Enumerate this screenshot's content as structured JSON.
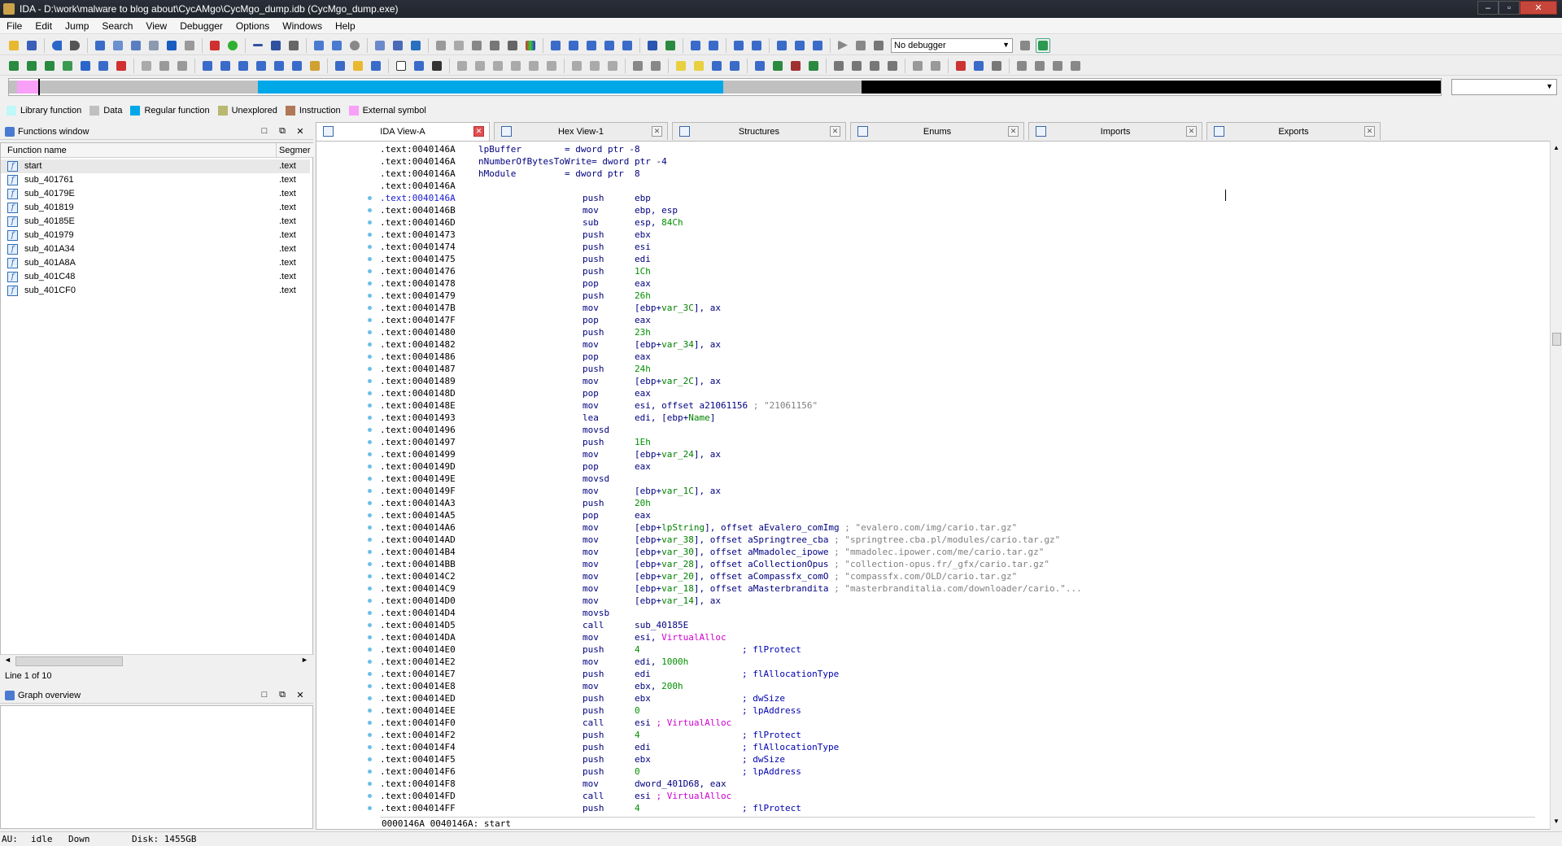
{
  "window": {
    "title": "IDA - D:\\work\\malware to blog about\\CycAMgo\\CycMgo_dump.idb (CycMgo_dump.exe)",
    "min": "–",
    "max": "▫",
    "close": "✕"
  },
  "menu": [
    "File",
    "Edit",
    "Jump",
    "Search",
    "View",
    "Debugger",
    "Options",
    "Windows",
    "Help"
  ],
  "toolbar": {
    "debugger_select": "No debugger"
  },
  "legend": [
    {
      "label": "Library function",
      "color": "#c0f8f8"
    },
    {
      "label": "Data",
      "color": "#c0c0c0"
    },
    {
      "label": "Regular function",
      "color": "#00a8e8"
    },
    {
      "label": "Unexplored",
      "color": "#b8b870"
    },
    {
      "label": "Instruction",
      "color": "#b07858"
    },
    {
      "label": "External symbol",
      "color": "#f8a0f8"
    }
  ],
  "functions_panel": {
    "title": "Functions window",
    "col_name": "Function name",
    "col_segment": "Segmer",
    "rows": [
      {
        "name": "start",
        "seg": ".text"
      },
      {
        "name": "sub_401761",
        "seg": ".text"
      },
      {
        "name": "sub_40179E",
        "seg": ".text"
      },
      {
        "name": "sub_401819",
        "seg": ".text"
      },
      {
        "name": "sub_40185E",
        "seg": ".text"
      },
      {
        "name": "sub_401979",
        "seg": ".text"
      },
      {
        "name": "sub_401A34",
        "seg": ".text"
      },
      {
        "name": "sub_401A8A",
        "seg": ".text"
      },
      {
        "name": "sub_401C48",
        "seg": ".text"
      },
      {
        "name": "sub_401CF0",
        "seg": ".text"
      }
    ],
    "line_info": "Line 1 of 10"
  },
  "graph_panel": {
    "title": "Graph overview"
  },
  "tabs": [
    {
      "label": "IDA View-A",
      "active": true
    },
    {
      "label": "Hex View-1",
      "active": false
    },
    {
      "label": "Structures",
      "active": false
    },
    {
      "label": "Enums",
      "active": false
    },
    {
      "label": "Imports",
      "active": false
    },
    {
      "label": "Exports",
      "active": false
    }
  ],
  "disasm": {
    "header_lines": [
      {
        "addr": ".text:0040146A",
        "label": "lpBuffer        = dword ptr -8"
      },
      {
        "addr": ".text:0040146A",
        "label": "nNumberOfBytesToWrite= dword ptr -4"
      },
      {
        "addr": ".text:0040146A",
        "label": "hModule         = dword ptr  8"
      },
      {
        "addr": ".text:0040146A",
        "label": ""
      }
    ],
    "lines": [
      {
        "addr": ".text:0040146A",
        "mn": "push",
        "op": "ebp",
        "hl": true
      },
      {
        "addr": ".text:0040146B",
        "mn": "mov",
        "op": "ebp, esp"
      },
      {
        "addr": ".text:0040146D",
        "mn": "sub",
        "op": "esp, 84Ch"
      },
      {
        "addr": ".text:00401473",
        "mn": "push",
        "op": "ebx"
      },
      {
        "addr": ".text:00401474",
        "mn": "push",
        "op": "esi"
      },
      {
        "addr": ".text:00401475",
        "mn": "push",
        "op": "edi"
      },
      {
        "addr": ".text:00401476",
        "mn": "push",
        "op": "1Ch"
      },
      {
        "addr": ".text:00401478",
        "mn": "pop",
        "op": "eax"
      },
      {
        "addr": ".text:00401479",
        "mn": "push",
        "op": "26h"
      },
      {
        "addr": ".text:0040147B",
        "mn": "mov",
        "op": "[ebp+var_3C], ax"
      },
      {
        "addr": ".text:0040147F",
        "mn": "pop",
        "op": "eax"
      },
      {
        "addr": ".text:00401480",
        "mn": "push",
        "op": "23h"
      },
      {
        "addr": ".text:00401482",
        "mn": "mov",
        "op": "[ebp+var_34], ax"
      },
      {
        "addr": ".text:00401486",
        "mn": "pop",
        "op": "eax"
      },
      {
        "addr": ".text:00401487",
        "mn": "push",
        "op": "24h"
      },
      {
        "addr": ".text:00401489",
        "mn": "mov",
        "op": "[ebp+var_2C], ax"
      },
      {
        "addr": ".text:0040148D",
        "mn": "pop",
        "op": "eax"
      },
      {
        "addr": ".text:0040148E",
        "mn": "mov",
        "op": "esi, offset a21061156 ; \"21061156\""
      },
      {
        "addr": ".text:00401493",
        "mn": "lea",
        "op": "edi, [ebp+Name]"
      },
      {
        "addr": ".text:00401496",
        "mn": "movsd",
        "op": ""
      },
      {
        "addr": ".text:00401497",
        "mn": "push",
        "op": "1Eh"
      },
      {
        "addr": ".text:00401499",
        "mn": "mov",
        "op": "[ebp+var_24], ax"
      },
      {
        "addr": ".text:0040149D",
        "mn": "pop",
        "op": "eax"
      },
      {
        "addr": ".text:0040149E",
        "mn": "movsd",
        "op": ""
      },
      {
        "addr": ".text:0040149F",
        "mn": "mov",
        "op": "[ebp+var_1C], ax"
      },
      {
        "addr": ".text:004014A3",
        "mn": "push",
        "op": "20h"
      },
      {
        "addr": ".text:004014A5",
        "mn": "pop",
        "op": "eax"
      },
      {
        "addr": ".text:004014A6",
        "mn": "mov",
        "op": "[ebp+lpString], offset aEvalero_comImg ; \"evalero.com/img/cario.tar.gz\""
      },
      {
        "addr": ".text:004014AD",
        "mn": "mov",
        "op": "[ebp+var_38], offset aSpringtree_cba ; \"springtree.cba.pl/modules/cario.tar.gz\""
      },
      {
        "addr": ".text:004014B4",
        "mn": "mov",
        "op": "[ebp+var_30], offset aMmadolec_ipowe ; \"mmadolec.ipower.com/me/cario.tar.gz\""
      },
      {
        "addr": ".text:004014BB",
        "mn": "mov",
        "op": "[ebp+var_28], offset aCollectionOpus ; \"collection-opus.fr/_gfx/cario.tar.gz\""
      },
      {
        "addr": ".text:004014C2",
        "mn": "mov",
        "op": "[ebp+var_20], offset aCompassfx_comO ; \"compassfx.com/OLD/cario.tar.gz\""
      },
      {
        "addr": ".text:004014C9",
        "mn": "mov",
        "op": "[ebp+var_18], offset aMasterbrandita ; \"masterbranditalia.com/downloader/cario.\"..."
      },
      {
        "addr": ".text:004014D0",
        "mn": "mov",
        "op": "[ebp+var_14], ax"
      },
      {
        "addr": ".text:004014D4",
        "mn": "movsb",
        "op": ""
      },
      {
        "addr": ".text:004014D5",
        "mn": "call",
        "op": "sub_40185E"
      },
      {
        "addr": ".text:004014DA",
        "mn": "mov",
        "op": "esi, VirtualAlloc"
      },
      {
        "addr": ".text:004014E0",
        "mn": "push",
        "op": "4",
        "cm": "; flProtect"
      },
      {
        "addr": ".text:004014E2",
        "mn": "mov",
        "op": "edi, 1000h"
      },
      {
        "addr": ".text:004014E7",
        "mn": "push",
        "op": "edi",
        "cm": "; flAllocationType"
      },
      {
        "addr": ".text:004014E8",
        "mn": "mov",
        "op": "ebx, 200h"
      },
      {
        "addr": ".text:004014ED",
        "mn": "push",
        "op": "ebx",
        "cm": "; dwSize"
      },
      {
        "addr": ".text:004014EE",
        "mn": "push",
        "op": "0",
        "cm": "; lpAddress"
      },
      {
        "addr": ".text:004014F0",
        "mn": "call",
        "op": "esi ; VirtualAlloc"
      },
      {
        "addr": ".text:004014F2",
        "mn": "push",
        "op": "4",
        "cm": "; flProtect"
      },
      {
        "addr": ".text:004014F4",
        "mn": "push",
        "op": "edi",
        "cm": "; flAllocationType"
      },
      {
        "addr": ".text:004014F5",
        "mn": "push",
        "op": "ebx",
        "cm": "; dwSize"
      },
      {
        "addr": ".text:004014F6",
        "mn": "push",
        "op": "0",
        "cm": "; lpAddress"
      },
      {
        "addr": ".text:004014F8",
        "mn": "mov",
        "op": "dword_401D68, eax"
      },
      {
        "addr": ".text:004014FD",
        "mn": "call",
        "op": "esi ; VirtualAlloc"
      },
      {
        "addr": ".text:004014FF",
        "mn": "push",
        "op": "4",
        "cm": "; flProtect"
      }
    ],
    "status": "0000146A 0040146A: start"
  },
  "statusbar": {
    "au": "AU:",
    "state": "idle",
    "dir": "Down",
    "disk": "Disk: 1455GB"
  }
}
